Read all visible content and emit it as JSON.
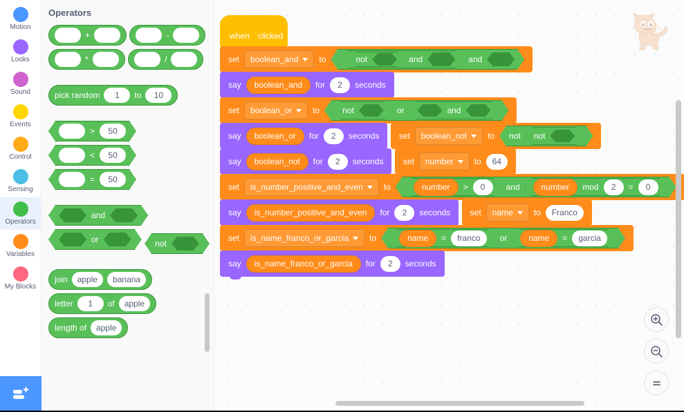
{
  "categories": [
    {
      "label": "Motion",
      "color": "#4c97ff",
      "selected": false
    },
    {
      "label": "Looks",
      "color": "#9966ff",
      "selected": false
    },
    {
      "label": "Sound",
      "color": "#cf63cf",
      "selected": false
    },
    {
      "label": "Events",
      "color": "#ffd500",
      "selected": false
    },
    {
      "label": "Control",
      "color": "#ffab19",
      "selected": false
    },
    {
      "label": "Sensing",
      "color": "#4cbfe6",
      "selected": false
    },
    {
      "label": "Operators",
      "color": "#40bf4a",
      "selected": true
    },
    {
      "label": "Variables",
      "color": "#ff8c1a",
      "selected": false
    },
    {
      "label": "My Blocks",
      "color": "#ff6680",
      "selected": false
    }
  ],
  "extension_button": {
    "icon": "add-extension-icon"
  },
  "palette": {
    "title": "Operators",
    "arithmetic": [
      {
        "operator": "+"
      },
      {
        "operator": "-"
      },
      {
        "operator": "*"
      },
      {
        "operator": "/"
      }
    ],
    "pick_random": {
      "label_start": "pick random",
      "from": "1",
      "label_mid": "to",
      "to": "10"
    },
    "comparisons": [
      {
        "operator": ">",
        "value": "50"
      },
      {
        "operator": "<",
        "value": "50"
      },
      {
        "operator": "=",
        "value": "50"
      }
    ],
    "booleans": [
      {
        "label": "and",
        "kind": "infix"
      },
      {
        "label": "or",
        "kind": "infix"
      },
      {
        "label": "not",
        "kind": "prefix"
      }
    ],
    "strings": [
      {
        "label": "join",
        "a": "apple",
        "b": "banana"
      },
      {
        "label_start": "letter",
        "index": "1",
        "label_mid": "of",
        "text": "apple"
      },
      {
        "label": "length of",
        "text": "apple"
      }
    ]
  },
  "workspace": {
    "watermark": "scratch-cat-icon",
    "zoom_controls": [
      {
        "name": "zoom-in",
        "glyph": "+"
      },
      {
        "name": "zoom-out",
        "glyph": "−"
      },
      {
        "name": "zoom-reset",
        "glyph": "="
      }
    ],
    "script": {
      "hat": {
        "label_before": "when",
        "icon": "green-flag-icon",
        "label_after": "clicked"
      },
      "blocks": [
        {
          "type": "set",
          "label": "set",
          "variable": "boolean_and",
          "to": "to",
          "value_expr": {
            "kind": "bool",
            "op": "and",
            "left": {
              "kind": "bool",
              "op": "and",
              "left": {
                "kind": "bool",
                "op": "not",
                "operand": "empty"
              },
              "right": "empty"
            },
            "right": "empty"
          }
        },
        {
          "type": "say",
          "label": "say",
          "variable": "boolean_and",
          "for": "for",
          "seconds": "2",
          "unit": "seconds"
        },
        {
          "type": "set",
          "label": "set",
          "variable": "boolean_or",
          "to": "to",
          "value_expr": {
            "kind": "bool",
            "op": "or",
            "left": {
              "kind": "bool",
              "op": "not",
              "operand": "empty"
            },
            "right": {
              "kind": "bool",
              "op": "and",
              "left": "empty",
              "right": "empty"
            }
          }
        },
        {
          "type": "say",
          "label": "say",
          "variable": "boolean_or",
          "for": "for",
          "seconds": "2",
          "unit": "seconds"
        },
        {
          "type": "set",
          "label": "set",
          "variable": "boolean_not",
          "to": "to",
          "value_expr": {
            "kind": "bool",
            "op": "not",
            "operand": {
              "kind": "bool",
              "op": "not",
              "operand": "empty"
            }
          }
        },
        {
          "type": "say",
          "label": "say",
          "variable": "boolean_not",
          "for": "for",
          "seconds": "2",
          "unit": "seconds"
        },
        {
          "type": "set_literal",
          "label": "set",
          "variable": "number",
          "to": "to",
          "value": "64"
        },
        {
          "type": "set",
          "label": "set",
          "variable": "is_number_positive_and_even",
          "to": "to",
          "value_expr": {
            "kind": "bool",
            "op": "and"
          }
        },
        {
          "type": "say",
          "label": "say",
          "variable": "is_number_positive_and_even",
          "for": "for",
          "seconds": "2",
          "unit": "seconds"
        },
        {
          "type": "set_literal",
          "label": "set",
          "variable": "name",
          "to": "to",
          "value": "Franco"
        },
        {
          "type": "set",
          "label": "set",
          "variable": "is_name_franco_or_garcia",
          "to": "to",
          "value_expr": {
            "kind": "bool",
            "op": "or"
          }
        },
        {
          "type": "say",
          "label": "say",
          "variable": "is_name_franco_or_garcia",
          "for": "for",
          "seconds": "2",
          "unit": "seconds"
        }
      ],
      "expr_number_even": {
        "left_var": "number",
        "left_op": ">",
        "left_val": "0",
        "join": "and",
        "right_var": "number",
        "right_mod": "mod",
        "right_mod_val": "2",
        "right_op": "=",
        "right_val": "0"
      },
      "expr_name_check": {
        "left_var": "name",
        "left_op": "=",
        "left_val": "franco",
        "join": "or",
        "right_var": "name",
        "right_op": "=",
        "right_val": "garcia"
      }
    }
  },
  "colors": {
    "operators": "#59c059",
    "variables": "#ff8c1a",
    "looks": "#9966ff",
    "events": "#ffbf00",
    "selected_category_bg": "#e9f1fc"
  }
}
